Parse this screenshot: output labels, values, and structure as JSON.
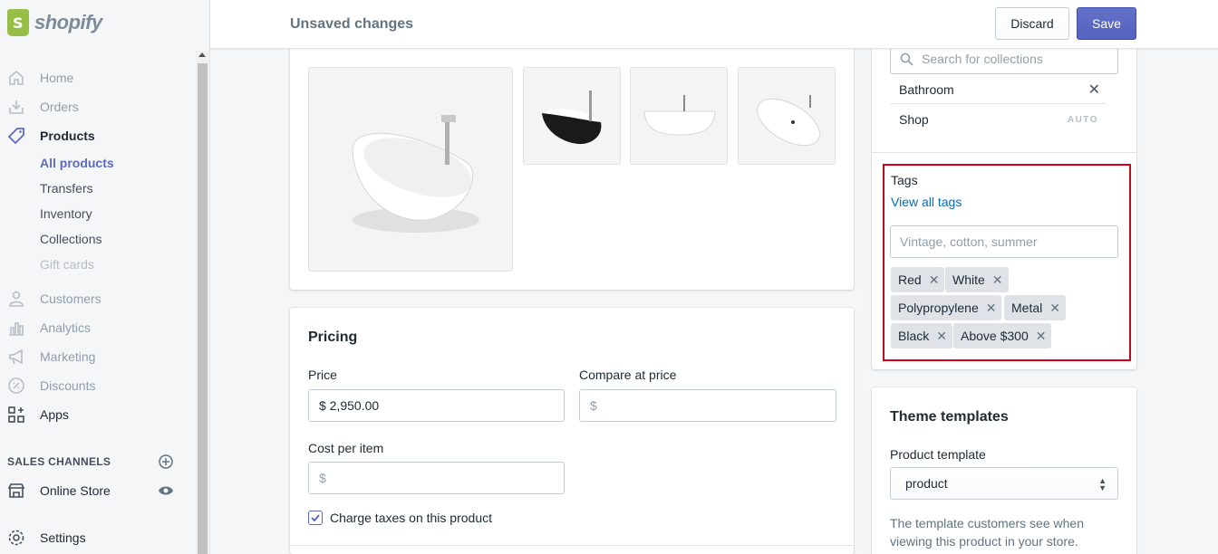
{
  "brand": {
    "name": "shopify"
  },
  "topbar": {
    "status": "Unsaved changes",
    "discard_label": "Discard",
    "save_label": "Save"
  },
  "sidebar": {
    "home": "Home",
    "orders": "Orders",
    "products": "Products",
    "products_sub": {
      "all_products": "All products",
      "transfers": "Transfers",
      "inventory": "Inventory",
      "collections": "Collections",
      "gift_cards": "Gift cards"
    },
    "customers": "Customers",
    "analytics": "Analytics",
    "marketing": "Marketing",
    "discounts": "Discounts",
    "apps": "Apps",
    "sales_channels_title": "SALES CHANNELS",
    "online_store": "Online Store",
    "settings": "Settings"
  },
  "pricing": {
    "title": "Pricing",
    "price_label": "Price",
    "price_value": "$ 2,950.00",
    "compare_label": "Compare at price",
    "compare_placeholder": "$",
    "cost_label": "Cost per item",
    "cost_placeholder": "$",
    "charge_taxes_label": "Charge taxes on this product",
    "charge_taxes_checked": true
  },
  "collections": {
    "search_placeholder": "Search for collections",
    "items": [
      {
        "name": "Bathroom",
        "removable": true
      },
      {
        "name": "Shop",
        "badge": "AUTO"
      }
    ]
  },
  "tags": {
    "title": "Tags",
    "view_all": "View all tags",
    "input_placeholder": "Vintage, cotton, summer",
    "items": [
      "Red",
      "White",
      "Polypropylene",
      "Metal",
      "Black",
      "Above $300"
    ]
  },
  "theme": {
    "title": "Theme templates",
    "template_label": "Product template",
    "template_value": "product",
    "help": "The template customers see when viewing this product in your store."
  },
  "colors": {
    "accent": "#5c6ac4",
    "link": "#006fbb",
    "highlight": "#d0021b",
    "brand_green": "#95bf47"
  }
}
